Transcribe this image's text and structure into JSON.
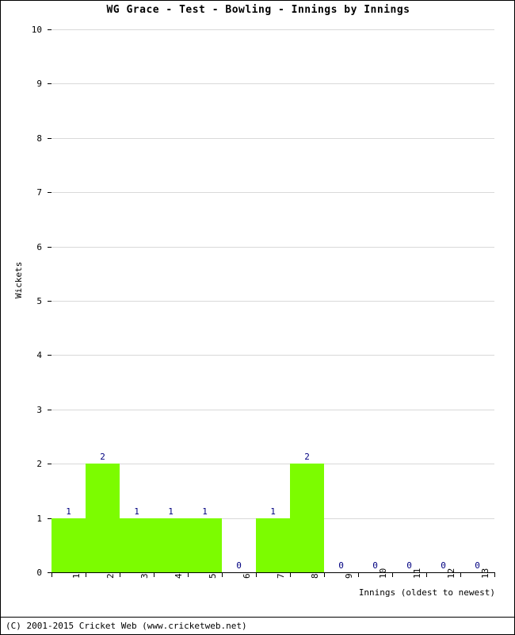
{
  "chart_data": {
    "type": "bar",
    "title": "WG Grace - Test - Bowling - Innings by Innings",
    "xlabel": "Innings (oldest to newest)",
    "ylabel": "Wickets",
    "categories": [
      "1",
      "2",
      "3",
      "4",
      "5",
      "6",
      "7",
      "8",
      "9",
      "10",
      "11",
      "12",
      "13"
    ],
    "values": [
      1,
      2,
      1,
      1,
      1,
      0,
      1,
      2,
      0,
      0,
      0,
      0,
      0
    ],
    "value_labels": [
      "1",
      "2",
      "1",
      "1",
      "1",
      "0",
      "1",
      "2",
      "0",
      "0",
      "0",
      "0",
      "0"
    ],
    "ylim": [
      0,
      10
    ],
    "ytick_labels": [
      "0",
      "1",
      "2",
      "3",
      "4",
      "5",
      "6",
      "7",
      "8",
      "9",
      "10"
    ],
    "ytick_values": [
      0,
      1,
      2,
      3,
      4,
      5,
      6,
      7,
      8,
      9,
      10
    ],
    "grid": true,
    "legend": null,
    "series": [
      {
        "name": "Wickets",
        "values": [
          1,
          2,
          1,
          1,
          1,
          0,
          1,
          2,
          0,
          0,
          0,
          0,
          0
        ]
      }
    ],
    "colors": {
      "bar": "#7cfc00",
      "value_label": "#000080",
      "gridline": "#d9d9d9",
      "axis": "#000000",
      "background": "#ffffff"
    }
  },
  "footer": {
    "copyright": "(C) 2001-2015 Cricket Web (www.cricketweb.net)"
  }
}
